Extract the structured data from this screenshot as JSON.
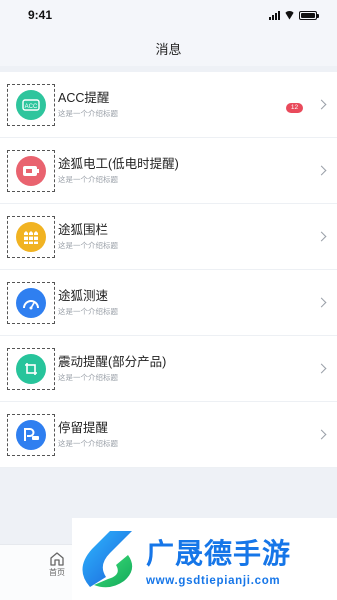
{
  "status_bar": {
    "time": "9:41"
  },
  "header": {
    "title": "消息"
  },
  "items": [
    {
      "title": "ACC提醒",
      "subtitle": "这是一个介绍标题",
      "badge": "12",
      "icon": "acc-icon",
      "color": "#2ec59d"
    },
    {
      "title": "途狐电工(低电时提醒)",
      "subtitle": "这是一个介绍标题",
      "icon": "battery-icon",
      "color": "#e9636f"
    },
    {
      "title": "途狐围栏",
      "subtitle": "这是一个介绍标题",
      "icon": "fence-icon",
      "color": "#f1b322"
    },
    {
      "title": "途狐测速",
      "subtitle": "这是一个介绍标题",
      "icon": "speedometer-icon",
      "color": "#2f7ff0"
    },
    {
      "title": "震动提醒(部分产品)",
      "subtitle": "这是一个介绍标题",
      "icon": "vibration-icon",
      "color": "#27c49b"
    },
    {
      "title": "停留提醒",
      "subtitle": "这是一个介绍标题",
      "icon": "parking-icon",
      "color": "#2f7ff0"
    }
  ],
  "tabbar": {
    "home_label": "首页"
  },
  "watermark": {
    "title": "广晟德手游",
    "url": "www.gsdtiepianji.com",
    "color": "#1676e8"
  }
}
